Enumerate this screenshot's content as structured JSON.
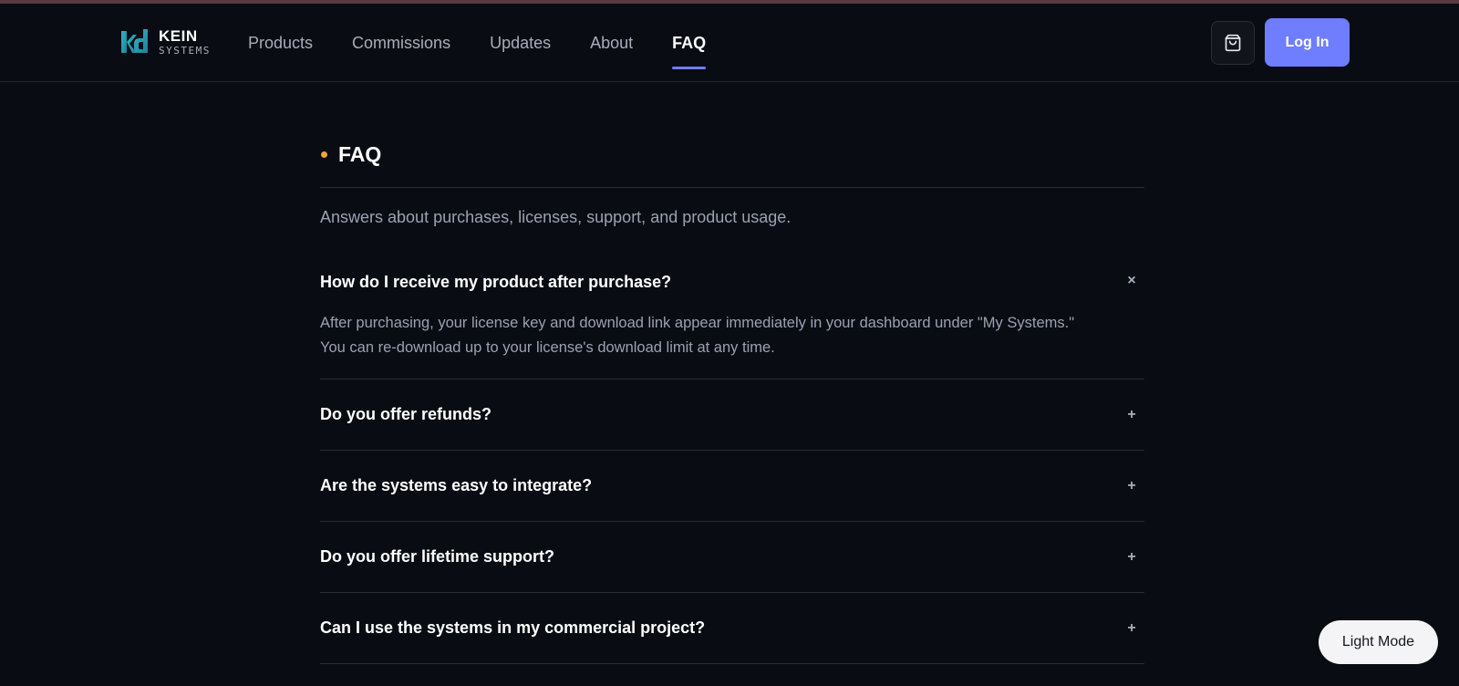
{
  "brand": {
    "name": "KEIN",
    "sub": "SYSTEMS"
  },
  "nav": {
    "items": [
      {
        "label": "Products",
        "active": false
      },
      {
        "label": "Commissions",
        "active": false
      },
      {
        "label": "Updates",
        "active": false
      },
      {
        "label": "About",
        "active": false
      },
      {
        "label": "FAQ",
        "active": true
      }
    ]
  },
  "header": {
    "cart_icon": "shopping-bag-icon",
    "login_label": "Log In"
  },
  "colors": {
    "accent": "#6f7dff",
    "dot": "#e7a83a",
    "background": "#0a0c13"
  },
  "page": {
    "title": "FAQ",
    "subtitle": "Answers about purchases, licenses, support, and product usage."
  },
  "faq": [
    {
      "question": "How do I receive my product after purchase?",
      "answer": "After purchasing, your license key and download link appear immediately in your dashboard under \"My Systems.\" You can re-download up to your license's download limit at any time.",
      "toggle": "×",
      "open": true
    },
    {
      "question": "Do you offer refunds?",
      "toggle": "+",
      "open": false
    },
    {
      "question": "Are the systems easy to integrate?",
      "toggle": "+",
      "open": false
    },
    {
      "question": "Do you offer lifetime support?",
      "toggle": "+",
      "open": false
    },
    {
      "question": "Can I use the systems in my commercial project?",
      "toggle": "+",
      "open": false
    }
  ],
  "theme_toggle": {
    "label": "Light Mode"
  }
}
